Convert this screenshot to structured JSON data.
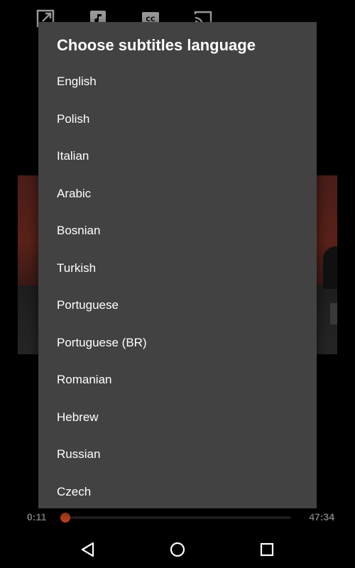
{
  "dialog": {
    "title": "Choose subtitles language",
    "languages": [
      "English",
      "Polish",
      "Italian",
      "Arabic",
      "Bosnian",
      "Turkish",
      "Portuguese",
      "Portuguese (BR)",
      "Romanian",
      "Hebrew",
      "Russian",
      "Czech"
    ]
  },
  "player": {
    "current_time": "0:11",
    "total_time": "47:34",
    "progress_fraction": 0.004,
    "accent_color": "#c2441a",
    "toolbar_icons": [
      "popout-icon",
      "audio-track-icon",
      "subtitles-icon",
      "cast-icon"
    ]
  },
  "navbar": {
    "icons": [
      "back-icon",
      "home-icon",
      "recents-icon"
    ]
  }
}
